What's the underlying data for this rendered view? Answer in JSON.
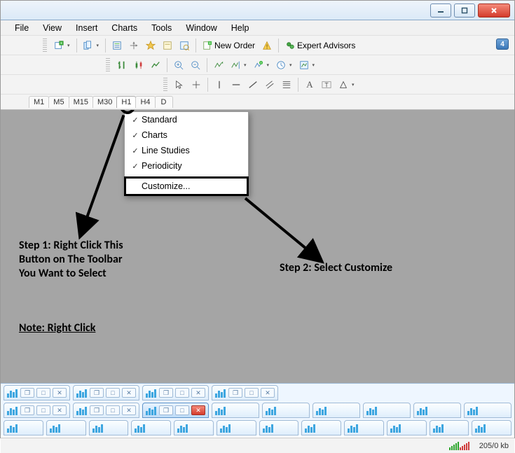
{
  "window_controls": {
    "minimize": "–",
    "maximize": "□",
    "close": "✕"
  },
  "menu": [
    "File",
    "View",
    "Insert",
    "Charts",
    "Tools",
    "Window",
    "Help"
  ],
  "toolbar1": {
    "new_order": "New Order",
    "expert_advisors": "Expert Advisors",
    "notif_badge": "4"
  },
  "period_tabs": [
    "M1",
    "M5",
    "M15",
    "M30",
    "H1",
    "H4",
    "D"
  ],
  "period_active": "H1",
  "context_menu": {
    "items": [
      {
        "label": "Standard",
        "checked": true
      },
      {
        "label": "Charts",
        "checked": true
      },
      {
        "label": "Line Studies",
        "checked": true
      },
      {
        "label": "Periodicity",
        "checked": true
      }
    ],
    "customize": "Customize..."
  },
  "annotations": {
    "step1": "Step 1: Right Click This\nButton on The Toolbar\nYou Want to Select",
    "step2": "Step 2: Select Customize",
    "note": "Note: Right Click"
  },
  "status": {
    "kb": "205/0 kb"
  }
}
